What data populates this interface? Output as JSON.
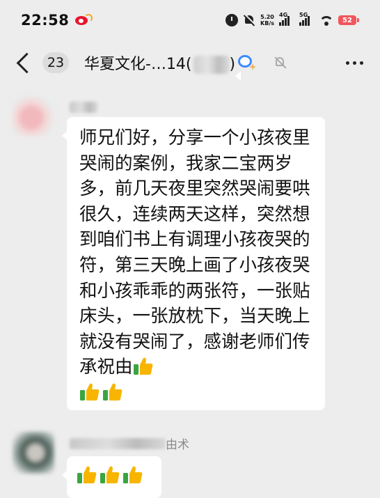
{
  "status_bar": {
    "time": "22:58",
    "net_speed_value": "5.20",
    "net_speed_unit": "KB/s",
    "signal_1_label": "4G",
    "signal_2_label": "5G",
    "battery": "52"
  },
  "header": {
    "unread_count": "23",
    "title_prefix": "华夏文化-…14(",
    "title_suffix": ")"
  },
  "messages": [
    {
      "sender_visible": "",
      "text": "师兄们好，分享一个小孩夜里哭闹的案例，我家二宝两岁多，前几天夜里突然哭闹要哄很久，连续两天这样，突然想到咱们书上有调理小孩夜哭的符，第三天晚上画了小孩夜哭和小孩乖乖的两张符，一张贴床头，一张放枕下，当天晚上就没有哭闹了，感谢老师们传承祝由",
      "emoji": [
        "thumbs-up",
        "thumbs-up",
        "thumbs-up"
      ]
    },
    {
      "sender_visible": "由术",
      "text": "",
      "emoji": [
        "thumbs-up",
        "thumbs-up",
        "thumbs-up"
      ]
    }
  ],
  "colors": {
    "background": "#ededed",
    "bubble": "#ffffff",
    "thumb_green": "#3aa53f",
    "thumb_yellow": "#f7b500",
    "battery": "#f0565c"
  }
}
